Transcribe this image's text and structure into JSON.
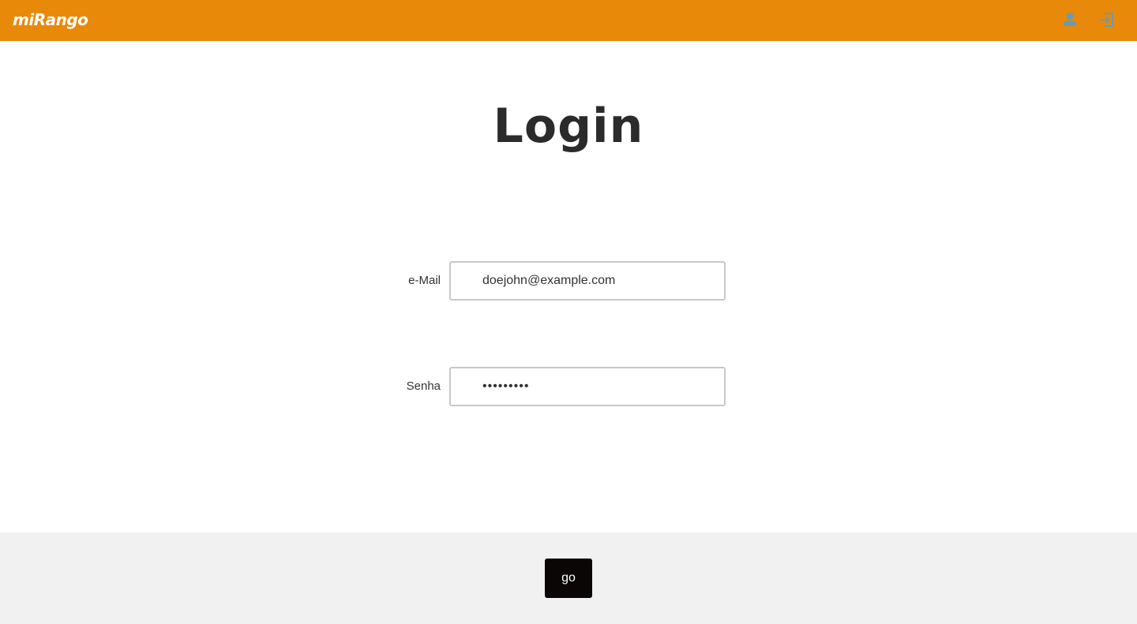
{
  "header": {
    "brand": "miRango",
    "background_color": "#e8890a",
    "icons": [
      {
        "name": "user-icon",
        "color": "#6a9bb3"
      },
      {
        "name": "login-icon",
        "color": "#6a9bb3"
      }
    ]
  },
  "page": {
    "title": "Login"
  },
  "form": {
    "email": {
      "label": "e-Mail",
      "value": "doejohn@example.com"
    },
    "password": {
      "label": "Senha",
      "value": "doejohn12"
    }
  },
  "footer": {
    "background_color": "#f1f1f1",
    "submit_label": "go"
  }
}
